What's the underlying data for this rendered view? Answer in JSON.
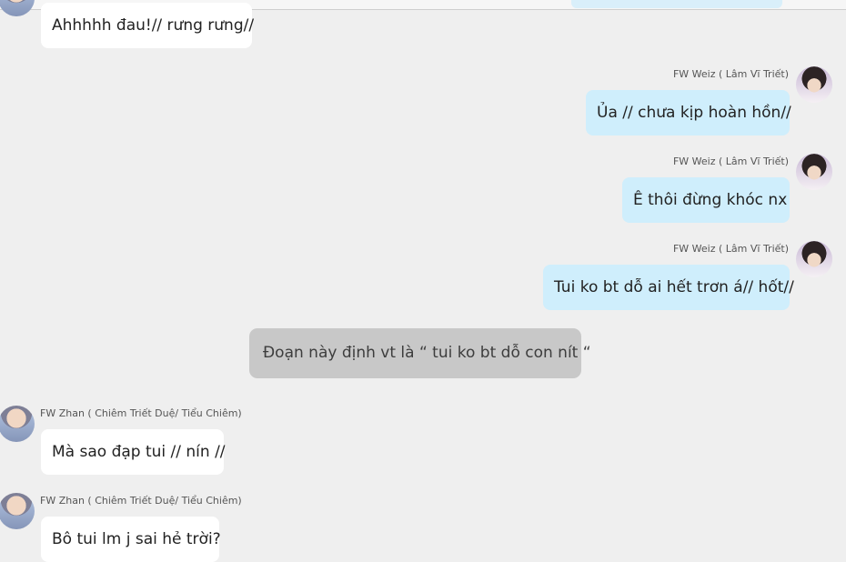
{
  "messages": [
    {
      "sender": "",
      "text": "Ahhhhh đau!// rưng rưng//"
    },
    {
      "sender": "FW Weiz ( Lâm Vĩ Triết)",
      "text": "Ủa // chưa kịp hoàn hồn//"
    },
    {
      "sender": "FW Weiz ( Lâm Vĩ Triết)",
      "text": "Ê thôi đừng khóc nx"
    },
    {
      "sender": "FW Weiz ( Lâm Vĩ Triết)",
      "text": "Tui ko bt dỗ ai hết trơn á// hốt//"
    },
    {
      "sender": "",
      "text": "Đoạn này định vt là “ tui ko bt dỗ con nít “"
    },
    {
      "sender": "FW Zhan ( Chiêm Triết Duệ/ Tiểu Chiêm)",
      "text": "Mà sao đạp tui // nín //"
    },
    {
      "sender": "FW Zhan ( Chiêm Triết Duệ/ Tiểu Chiêm)",
      "text": "Bô tui lm j sai hẻ trời?"
    }
  ],
  "colors": {
    "background": "#efefef",
    "left_bubble": "#ffffff",
    "right_bubble": "#cfeefc",
    "system_bubble": "#c8c8c8"
  },
  "icons": {
    "zhan_avatar": "avatar-zhan",
    "weiz_avatar": "avatar-weiz"
  }
}
